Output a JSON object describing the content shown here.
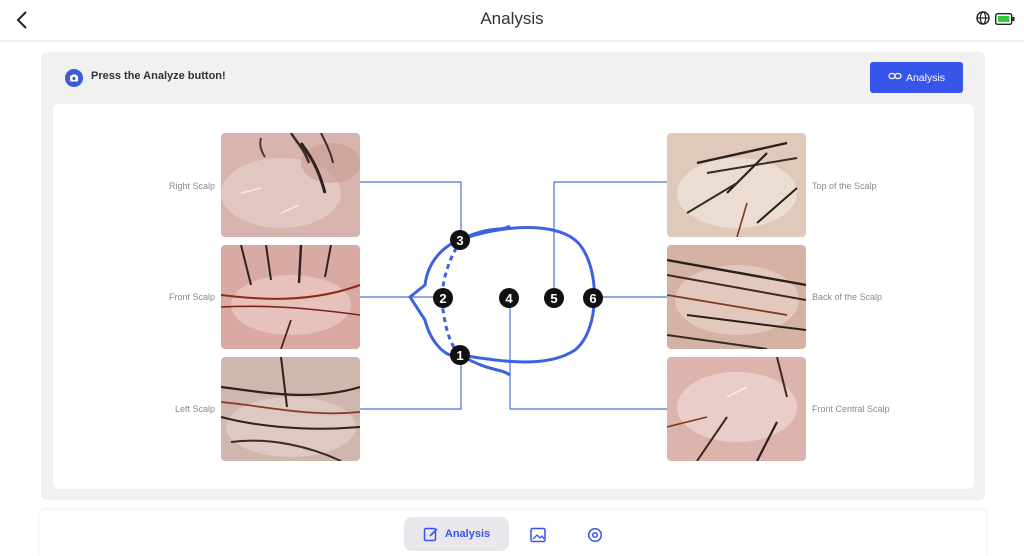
{
  "header": {
    "title": "Analysis"
  },
  "instruction": {
    "text": "Press the Analyze button!"
  },
  "actions": {
    "analysis_label": "Analysis"
  },
  "photos": [
    {
      "label": "Right Scalp"
    },
    {
      "label": "Front Scalp"
    },
    {
      "label": "Left Scalp"
    },
    {
      "label": "Top of the Scalp"
    },
    {
      "label": "Back of the Scalp"
    },
    {
      "label": "Front Central Scalp"
    }
  ],
  "markers": [
    "1",
    "2",
    "3",
    "4",
    "5",
    "6"
  ],
  "bottom_nav": {
    "analysis_label": "Analysis"
  },
  "colors": {
    "accent": "#3755e8",
    "diagram": "#3b63e0",
    "battery": "#2ecc40"
  },
  "icons": [
    "back-arrow-icon",
    "globe-icon",
    "battery-icon",
    "camera-icon",
    "link-icon",
    "edit-icon",
    "image-icon",
    "settings-icon"
  ]
}
